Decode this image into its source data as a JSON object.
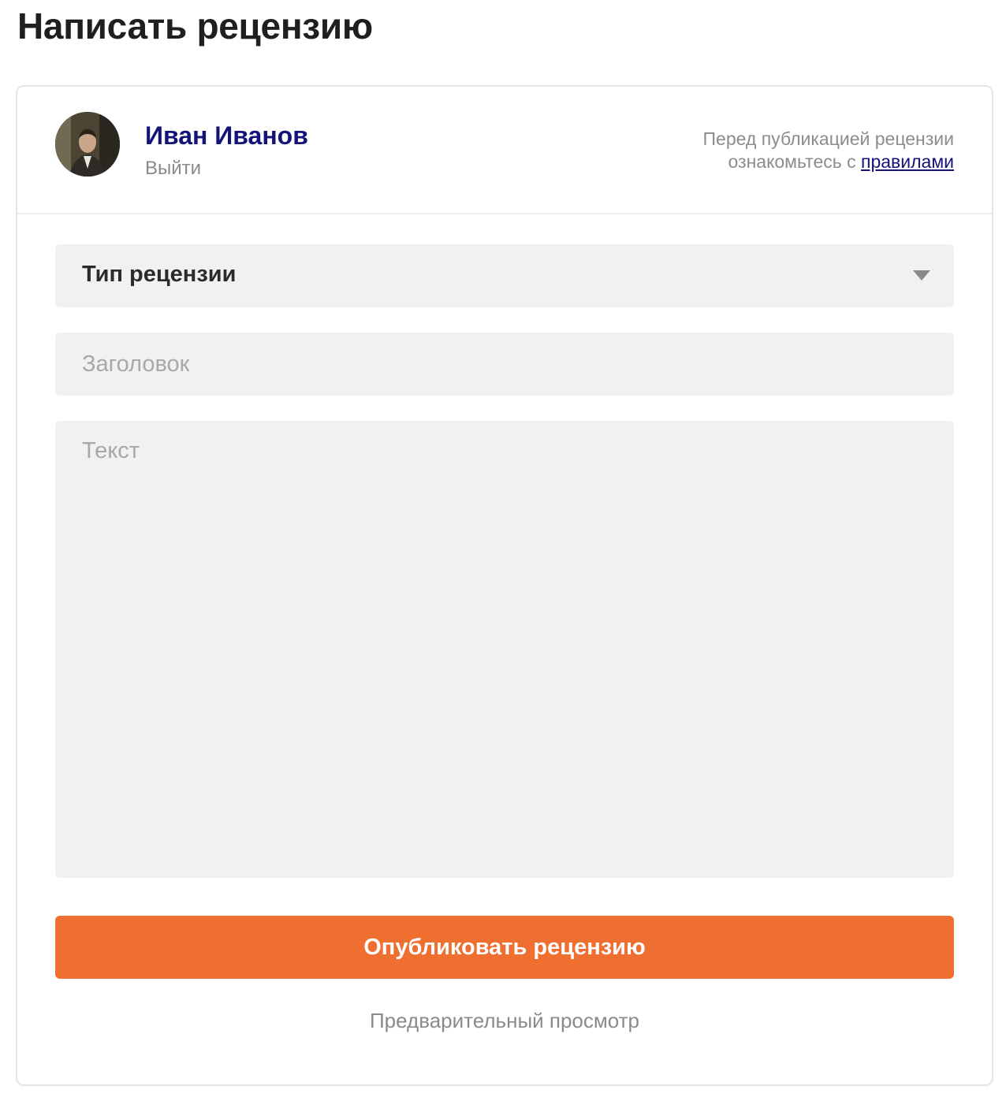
{
  "page": {
    "title": "Написать рецензию"
  },
  "user": {
    "name": "Иван Иванов",
    "logout_label": "Выйти",
    "avatar_icon": "user-photo"
  },
  "rules_note": {
    "line1": "Перед публикацией рецензии",
    "line2_prefix": "ознакомьтесь с ",
    "link_label": "правилами"
  },
  "form": {
    "review_type": {
      "selected": "Тип рецензии",
      "icon": "chevron-down-icon"
    },
    "title_placeholder": "Заголовок",
    "title_value": "",
    "text_placeholder": "Текст",
    "text_value": ""
  },
  "actions": {
    "publish_label": "Опубликовать рецензию",
    "preview_label": "Предварительный просмотр"
  },
  "colors": {
    "accent": "#ee6f30",
    "link": "#141478",
    "field_bg": "#f1f1f1"
  }
}
